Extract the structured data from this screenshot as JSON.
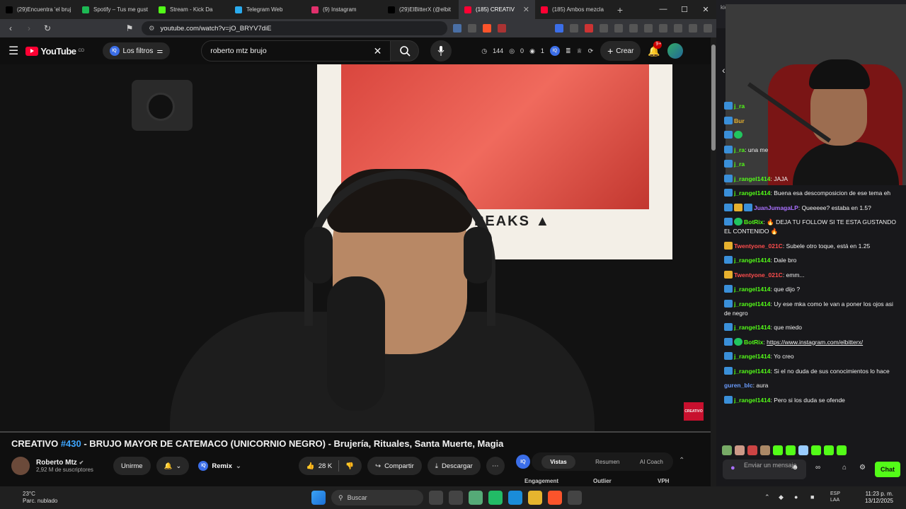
{
  "tabs": [
    {
      "label": "(29)Encuentra 'el bruj",
      "color": "#000000"
    },
    {
      "label": "Spotify – Tus me gust",
      "color": "#1db954"
    },
    {
      "label": "Stream - Kick Da",
      "color": "#53fc18"
    },
    {
      "label": "Telegram Web",
      "color": "#2aabee"
    },
    {
      "label": "(9) Instagram",
      "color": "#e1306c"
    },
    {
      "label": "(29)ElBitterX (@elbit",
      "color": "#000000"
    },
    {
      "label": "(185) CREATIV",
      "color": "#ff0033",
      "active": true
    },
    {
      "label": "(185) Ambos mezcla",
      "color": "#ff0033"
    }
  ],
  "address": {
    "url": "youtube.com/watch?v=jO_BRYV7diE"
  },
  "yt": {
    "logo": "YouTube",
    "country": "CO",
    "filters": "Los filtros",
    "search_value": "roberto mtz brujo",
    "stat1": "144",
    "stat2": "0",
    "stat3": "1",
    "create": "Crear",
    "notif": "9+"
  },
  "video": {
    "poster_text": "PEAKS ▲",
    "corner_logo": "CREATIVO",
    "title_prefix": "CREATIVO ",
    "title_num": "#430",
    "title_rest": " - BRUJO MAYOR DE CATEMACO (UNICORNIO NEGRO) - Brujería, Rituales, Santa Muerte, Magia",
    "channel": "Roberto Mtz",
    "subs": "2,92 M de suscriptores",
    "join": "Unirme",
    "remix": "Remix",
    "likes": "28 K",
    "share": "Compartir",
    "download": "Descargar"
  },
  "vidiq": {
    "logo": "IQ",
    "tabs": [
      "Vistas",
      "Resumen",
      "AI Coach"
    ],
    "headers": [
      "Engagement",
      "Outlier",
      "VPH"
    ]
  },
  "right": {
    "url_stub": "kick.co",
    "tab_stub": "kick",
    "chat": [
      {
        "user": "j_ra",
        "color": "#53fc18",
        "text": "",
        "badges": [
          "bot"
        ]
      },
      {
        "user": "Bur",
        "color": "#e6b02e",
        "text": "",
        "badges": [
          "bot"
        ]
      },
      {
        "user": "",
        "color": "#53fc18",
        "text": "",
        "badges": [
          "bot",
          "check"
        ]
      },
      {
        "user": "j_ra",
        "color": "#53fc18",
        "text": "una me",
        "badges": [
          "bot"
        ]
      },
      {
        "user": "j_ra",
        "color": "#53fc18",
        "text": "",
        "badges": [
          "bot"
        ]
      },
      {
        "user": "j_rangel1414",
        "color": "#53fc18",
        "text": "JAJA",
        "badges": [
          "bot"
        ]
      },
      {
        "user": "j_rangel1414",
        "color": "#53fc18",
        "text": "Buena esa descomposicion de ese tema eh",
        "badges": [
          "bot"
        ]
      },
      {
        "user": "JuanJumagaLP",
        "color": "#a970ff",
        "text": "Queeeee? estaba en 1.5?",
        "badges": [
          "bot",
          "crown",
          "bot"
        ]
      },
      {
        "user": "BotRix",
        "color": "#53fc18",
        "text": "🔥 DEJA TU FOLLOW SI TE ESTA GUSTANDO EL CONTENIDO 🔥",
        "badges": [
          "bot",
          "check"
        ]
      },
      {
        "user": "Twentyone_021C",
        "color": "#ff4d4d",
        "text": "Subele otro toque, está en 1.25",
        "badges": [
          "crown"
        ]
      },
      {
        "user": "j_rangel1414",
        "color": "#53fc18",
        "text": "Dale bro",
        "badges": [
          "bot"
        ]
      },
      {
        "user": "Twentyone_021C",
        "color": "#ff4d4d",
        "text": "emm...",
        "badges": [
          "crown"
        ]
      },
      {
        "user": "j_rangel1414",
        "color": "#53fc18",
        "text": "que dijo ?",
        "badges": [
          "bot"
        ]
      },
      {
        "user": "j_rangel1414",
        "color": "#53fc18",
        "text": "Uy ese mka como le van a poner los ojos asi de negro",
        "badges": [
          "bot"
        ]
      },
      {
        "user": "j_rangel1414",
        "color": "#53fc18",
        "text": "que miedo",
        "badges": [
          "bot"
        ]
      },
      {
        "user": "BotRix",
        "color": "#53fc18",
        "text": "https://www.instagram.com/elbitterx/",
        "link": true,
        "badges": [
          "bot",
          "check"
        ]
      },
      {
        "user": "j_rangel1414",
        "color": "#53fc18",
        "text": "Yo creo",
        "badges": [
          "bot"
        ]
      },
      {
        "user": "j_rangel1414",
        "color": "#53fc18",
        "text": "Si el no duda de sus conocimientos lo hace",
        "badges": [
          "bot"
        ]
      },
      {
        "user": "guren_blc",
        "color": "#6a9cff",
        "text": "aura",
        "badges": []
      },
      {
        "user": "j_rangel1414",
        "color": "#53fc18",
        "text": "Pero si los duda se ofende",
        "badges": [
          "bot"
        ]
      }
    ],
    "input_placeholder": "Enviar un mensaje",
    "chat_button": "Chat"
  },
  "taskbar": {
    "temp": "23°C",
    "weather": "Parc. nublado",
    "search": "Buscar",
    "lang1": "ESP",
    "lang2": "LAA",
    "time": "11:23 p. m.",
    "date": "13/12/2025"
  }
}
